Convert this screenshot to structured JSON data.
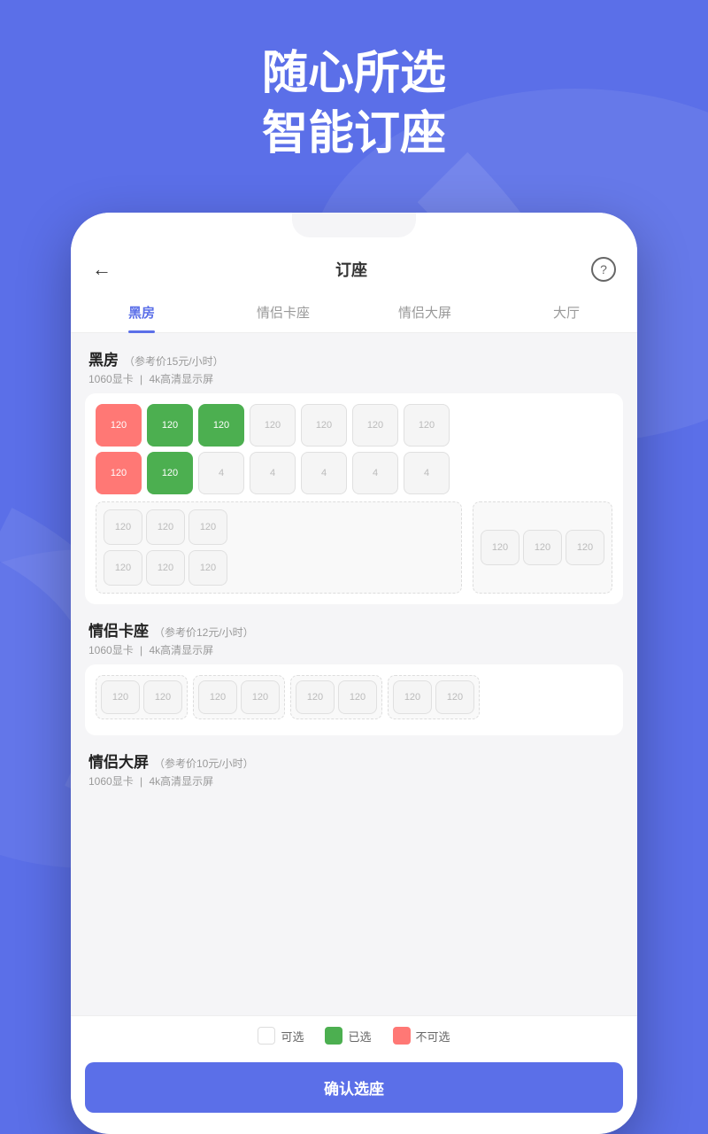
{
  "background_color": "#5b6fe8",
  "header": {
    "line1": "随心所选",
    "line2": "智能订座"
  },
  "topbar": {
    "title": "订座",
    "back_icon": "←",
    "help_icon": "?"
  },
  "tabs": [
    {
      "label": "黑房",
      "active": true
    },
    {
      "label": "情侣卡座",
      "active": false
    },
    {
      "label": "情侣大屏",
      "active": false
    },
    {
      "label": "大厅",
      "active": false
    }
  ],
  "sections": [
    {
      "id": "heifang",
      "title": "黑房",
      "price": "（参考价15元/小时）",
      "specs": "1060显卡  |  4k高清显示屏",
      "rows": [
        [
          {
            "label": "120",
            "status": "unavailable"
          },
          {
            "label": "120",
            "status": "selected"
          },
          {
            "label": "120",
            "status": "selected"
          },
          {
            "label": "120",
            "status": "available"
          },
          {
            "label": "120",
            "status": "available"
          },
          {
            "label": "120",
            "status": "available"
          },
          {
            "label": "120",
            "status": "available"
          }
        ],
        [
          {
            "label": "120",
            "status": "unavailable"
          },
          {
            "label": "120",
            "status": "selected"
          },
          {
            "label": "4",
            "status": "available"
          },
          {
            "label": "4",
            "status": "available"
          },
          {
            "label": "4",
            "status": "available"
          },
          {
            "label": "4",
            "status": "available"
          },
          {
            "label": "4",
            "status": "available"
          }
        ]
      ],
      "bottom_groups": [
        {
          "seats": [
            [
              {
                "label": "120",
                "status": "available"
              },
              {
                "label": "120",
                "status": "available"
              },
              {
                "label": "120",
                "status": "available"
              }
            ],
            [
              {
                "label": "120",
                "status": "available"
              },
              {
                "label": "120",
                "status": "available"
              },
              {
                "label": "120",
                "status": "available"
              }
            ]
          ]
        },
        {
          "seats": [
            [
              {
                "label": "120",
                "status": "available"
              },
              {
                "label": "120",
                "status": "available"
              },
              {
                "label": "120",
                "status": "available"
              }
            ]
          ]
        }
      ]
    },
    {
      "id": "qinglv_kazuo",
      "title": "情侣卡座",
      "price": "（参考价12元/小时）",
      "specs": "1060显卡  |  4k高清显示屏",
      "sofa_row": [
        {
          "label": "120",
          "status": "available"
        },
        {
          "label": "120",
          "status": "available"
        },
        {
          "label": "120",
          "status": "available"
        },
        {
          "label": "120",
          "status": "available"
        },
        {
          "label": "120",
          "status": "available"
        },
        {
          "label": "120",
          "status": "available"
        },
        {
          "label": "120",
          "status": "available"
        },
        {
          "label": "120",
          "status": "available"
        }
      ]
    },
    {
      "id": "qinglv_dapin",
      "title": "情侣大屏",
      "price": "（参考价10元/小时）",
      "specs": "1060显卡  |  4k高清显示屏"
    }
  ],
  "legend": [
    {
      "label": "可选",
      "type": "available"
    },
    {
      "label": "已选",
      "type": "selected"
    },
    {
      "label": "不可选",
      "type": "unavailable"
    }
  ],
  "confirm_button": "确认选座"
}
